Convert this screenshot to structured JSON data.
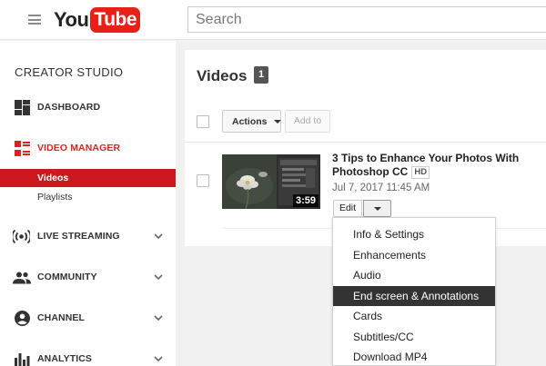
{
  "header": {
    "logo_you": "You",
    "logo_tube": "Tube",
    "search_placeholder": "Search"
  },
  "sidebar": {
    "title": "CREATOR STUDIO",
    "items": [
      {
        "label": "DASHBOARD",
        "icon": "dashboard-icon"
      },
      {
        "label": "VIDEO MANAGER",
        "icon": "video-manager-icon",
        "active": true
      },
      {
        "label": "LIVE STREAMING",
        "icon": "live-streaming-icon"
      },
      {
        "label": "COMMUNITY",
        "icon": "community-icon"
      },
      {
        "label": "CHANNEL",
        "icon": "channel-icon"
      },
      {
        "label": "ANALYTICS",
        "icon": "analytics-icon"
      }
    ],
    "subitems": [
      {
        "label": "Videos",
        "selected": true
      },
      {
        "label": "Playlists"
      }
    ],
    "active_color": "#cc181e"
  },
  "main": {
    "title": "Videos",
    "count": "1",
    "actions_label": "Actions",
    "addto_label": "Add to",
    "video": {
      "title": "3 Tips to Enhance Your Photos With Photoshop CC",
      "hd": "HD",
      "date": "Jul 7, 2017 11:45 AM",
      "duration": "3:59",
      "edit_label": "Edit"
    }
  },
  "dropdown": {
    "items": [
      "Info & Settings",
      "Enhancements",
      "Audio",
      "End screen & Annotations",
      "Cards",
      "Subtitles/CC",
      "Download MP4"
    ],
    "highlighted_index": 3
  }
}
